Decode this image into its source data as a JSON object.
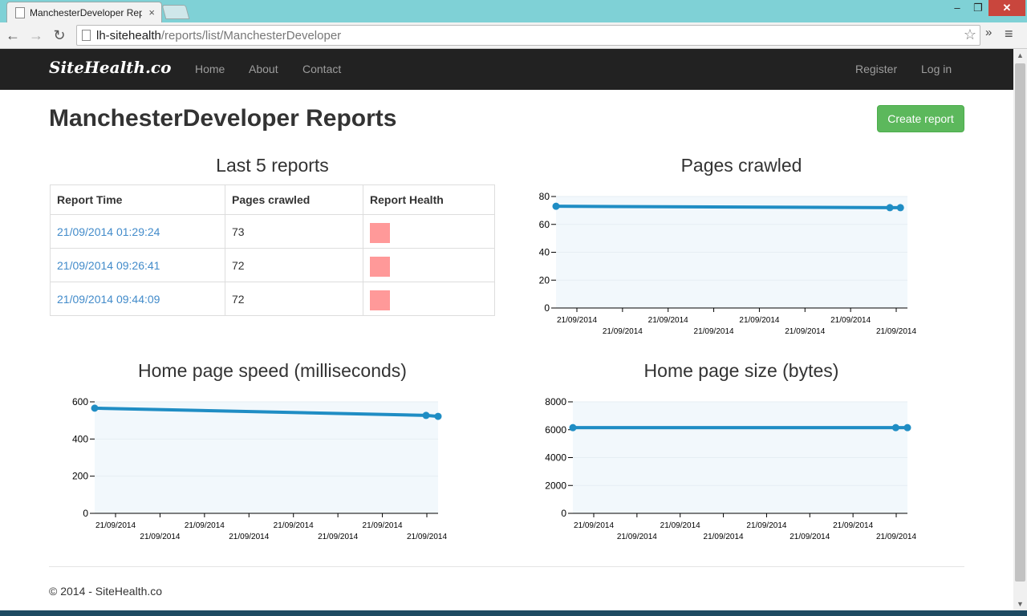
{
  "browser": {
    "tab_title": "ManchesterDeveloper Rep",
    "url_host": "lh-sitehealth",
    "url_path": "/reports/list/ManchesterDeveloper"
  },
  "navbar": {
    "brand": "SiteHealth.co",
    "links": [
      "Home",
      "About",
      "Contact"
    ],
    "right_links": [
      "Register",
      "Log in"
    ]
  },
  "page": {
    "title": "ManchesterDeveloper Reports",
    "create_button": "Create report"
  },
  "reports_table": {
    "title": "Last 5 reports",
    "headers": [
      "Report Time",
      "Pages crawled",
      "Report Health"
    ],
    "rows": [
      {
        "time": "21/09/2014 01:29:24",
        "pages": "73"
      },
      {
        "time": "21/09/2014 09:26:41",
        "pages": "72"
      },
      {
        "time": "21/09/2014 09:44:09",
        "pages": "72"
      }
    ],
    "health_color": "#ff9999"
  },
  "chart_data": [
    {
      "type": "area",
      "title": "Pages crawled",
      "x": [
        "21/09/2014 01:29:24",
        "21/09/2014 09:26:41",
        "21/09/2014 09:44:09"
      ],
      "x_fraction": [
        0,
        0.95,
        0.98
      ],
      "series": [
        {
          "values": [
            73,
            72,
            72
          ]
        }
      ],
      "ylim": [
        0,
        80
      ],
      "yticks": [
        0,
        20,
        40,
        60,
        80
      ],
      "xtick_labels": [
        "21/09/2014",
        "21/09/2014",
        "21/09/2014",
        "21/09/2014",
        "21/09/2014",
        "21/09/2014",
        "21/09/2014",
        "21/09/2014"
      ],
      "line_color": "#1f8dc4",
      "fill_color": "#f2f8fc"
    },
    {
      "type": "area",
      "title": "Home page speed (milliseconds)",
      "x": [
        "21/09/2014 01:29:24",
        "21/09/2014 09:26:41",
        "21/09/2014 09:44:09"
      ],
      "x_fraction": [
        0,
        0.965,
        1.0
      ],
      "series": [
        {
          "values": [
            566,
            527,
            522
          ]
        }
      ],
      "ylim": [
        0,
        600
      ],
      "yticks": [
        0,
        200,
        400,
        600
      ],
      "xtick_labels": [
        "21/09/2014",
        "21/09/2014",
        "21/09/2014",
        "21/09/2014",
        "21/09/2014",
        "21/09/2014",
        "21/09/2014",
        "21/09/2014"
      ],
      "line_color": "#1f8dc4",
      "fill_color": "#f2f8fc"
    },
    {
      "type": "area",
      "title": "Home page size (bytes)",
      "x": [
        "21/09/2014 01:29:24",
        "21/09/2014 09:26:41",
        "21/09/2014 09:44:09"
      ],
      "x_fraction": [
        0,
        0.965,
        1.0
      ],
      "series": [
        {
          "values": [
            6150,
            6150,
            6150
          ]
        }
      ],
      "ylim": [
        0,
        8000
      ],
      "yticks": [
        0,
        2000,
        4000,
        6000,
        8000
      ],
      "xtick_labels": [
        "21/09/2014",
        "21/09/2014",
        "21/09/2014",
        "21/09/2014",
        "21/09/2014",
        "21/09/2014",
        "21/09/2014",
        "21/09/2014"
      ],
      "line_color": "#1f8dc4",
      "fill_color": "#f2f8fc"
    }
  ],
  "footer": {
    "text": "© 2014 - SiteHealth.co"
  }
}
